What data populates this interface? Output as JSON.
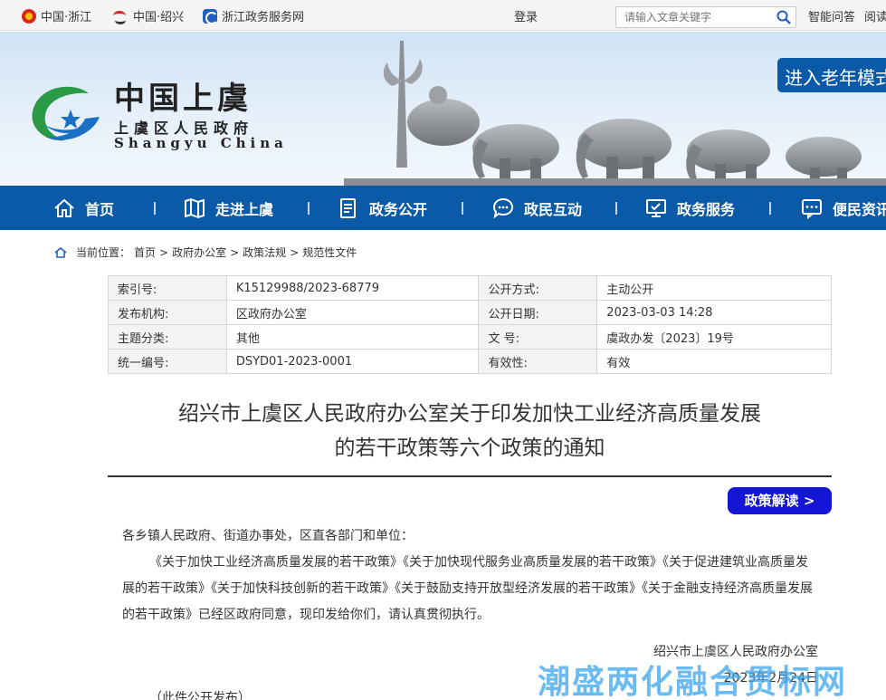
{
  "topbar": {
    "links": [
      "中国·浙江",
      "中国·绍兴",
      "浙江政务服务网"
    ],
    "login": "登录",
    "search_placeholder": "请输入文章关键字",
    "smart_qa": "智能问答",
    "reading": "阅读"
  },
  "header": {
    "logo_title": "中国上虞",
    "logo_subtitle": "上虞区人民政府",
    "logo_en": "Shangyu China",
    "elder_mode": "进入老年模式"
  },
  "nav": {
    "items": [
      {
        "label": "首页",
        "icon": "home-icon"
      },
      {
        "label": "走进上虞",
        "icon": "map-icon"
      },
      {
        "label": "政务公开",
        "icon": "document-icon"
      },
      {
        "label": "政民互动",
        "icon": "chat-icon"
      },
      {
        "label": "政务服务",
        "icon": "monitor-icon"
      },
      {
        "label": "便民资讯",
        "icon": "message-icon"
      }
    ]
  },
  "breadcrumb": {
    "prefix": "当前位置：",
    "items": [
      "首页",
      "政府办公室",
      "政策法规",
      "规范性文件"
    ]
  },
  "meta": {
    "rows": [
      [
        "索引号:",
        "K15129988/2023-68779",
        "公开方式:",
        "主动公开"
      ],
      [
        "发布机构:",
        "区政府办公室",
        "公开日期:",
        "2023-03-03 14:28"
      ],
      [
        "主题分类:",
        "其他",
        "文 号:",
        "虞政办发〔2023〕19号"
      ],
      [
        "统一编号:",
        "DSYD01-2023-0001",
        "有效性:",
        "有效"
      ]
    ]
  },
  "doc": {
    "title_line1": "绍兴市上虞区人民政府办公室关于印发加快工业经济高质量发展",
    "title_line2": "的若干政策等六个政策的通知",
    "policy_button": "政策解读 >",
    "salutation": "各乡镇人民政府、街道办事处，区直各部门和单位：",
    "paragraph": "《关于加快工业经济高质量发展的若干政策》《关于加快现代服务业高质量发展的若干政策》《关于促进建筑业高质量发展的若干政策》《关于加快科技创新的若干政策》《关于鼓励支持开放型经济发展的若干政策》《关于金融支持经济高质量发展的若干政策》已经区政府同意，现印发给你们，请认真贯彻执行。",
    "signature": "绍兴市上虞区人民政府办公室",
    "date": "2023年2月24日",
    "footnote": "（此件公开发布）"
  },
  "watermark": "潮盛两化融合贯标网",
  "colors": {
    "nav_blue": "#0a5aa8",
    "policy_button": "#1416d6",
    "watermark": "#41a8f0"
  }
}
